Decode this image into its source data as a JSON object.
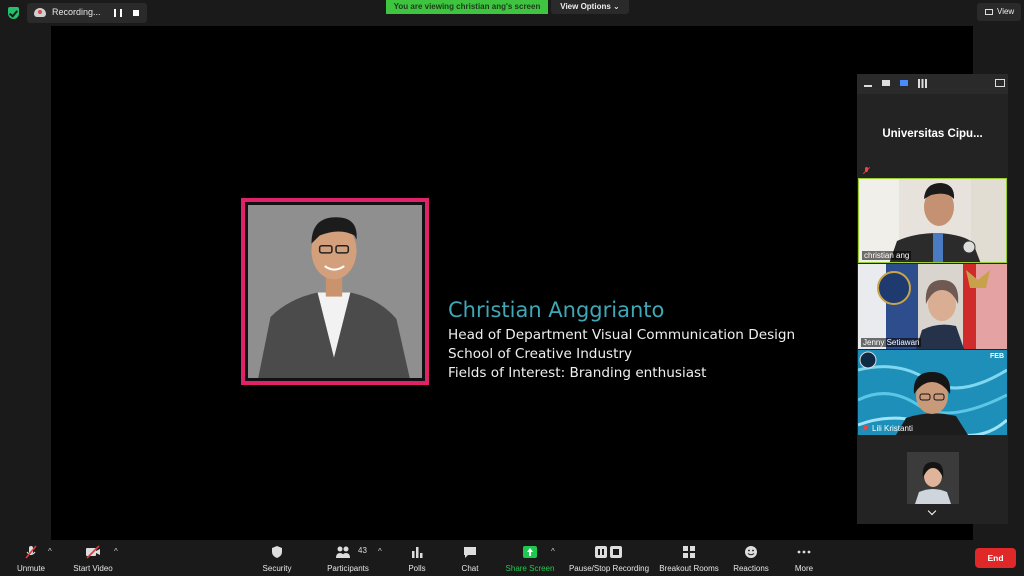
{
  "top_bar": {
    "recording_label": "Recording...",
    "viewing_banner": "You are viewing christian ang's screen",
    "view_options_label": "View Options",
    "view_label": "View"
  },
  "slide": {
    "name": "Christian Anggrianto",
    "lines": [
      "Head of Department Visual Communication Design",
      "School of Creative Industry",
      "Fields of Interest: Branding enthusiast"
    ],
    "frame_color": "#e0226a",
    "name_color": "#3fa7b5"
  },
  "panel": {
    "title": "Universitas  Cipu...",
    "participants": [
      {
        "name": "christian ang",
        "muted": false
      },
      {
        "name": "Jenny Setiawan",
        "muted": false
      },
      {
        "name": "Lili Kristanti",
        "muted": true,
        "tag": "FEB"
      }
    ]
  },
  "toolbar": {
    "unmute": "Unmute",
    "start_video": "Start Video",
    "security": "Security",
    "participants": "Participants",
    "participants_count": "43",
    "polls": "Polls",
    "chat": "Chat",
    "share_screen": "Share Screen",
    "pause_stop_recording": "Pause/Stop Recording",
    "breakout_rooms": "Breakout Rooms",
    "reactions": "Reactions",
    "more": "More",
    "end": "End",
    "share_color": "#1fc94f",
    "end_color": "#e02828"
  }
}
